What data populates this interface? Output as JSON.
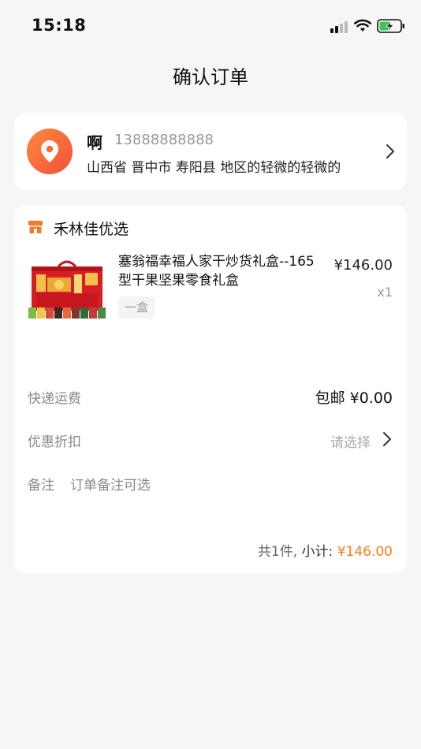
{
  "status_bar": {
    "time": "15:18"
  },
  "header": {
    "title": "确认订单"
  },
  "address": {
    "name": "啊",
    "phone": "13888888888",
    "detail": "山西省 晋中市 寿阳县 地区的轻微的轻微的"
  },
  "store": {
    "name": "禾林佳优选"
  },
  "product": {
    "name": "塞翁福幸福人家干炒货礼盒--165型干果坚果零食礼盒",
    "spec": "一盒",
    "price": "¥146.00",
    "qty": "x1"
  },
  "shipping": {
    "label": "快递运费",
    "value": "包邮 ¥0.00"
  },
  "discount": {
    "label": "优惠折扣",
    "value": "请选择"
  },
  "note": {
    "label": "备注",
    "placeholder": "订单备注可选"
  },
  "summary": {
    "count": "共1件,",
    "subtotal_label": "小计:",
    "amount": "¥146.00"
  },
  "colors": {
    "accent": "#ff7a1a",
    "location_gradient_start": "#ff8a3c",
    "location_gradient_end": "#f24f3a",
    "store_icon": "#f07a2a"
  }
}
